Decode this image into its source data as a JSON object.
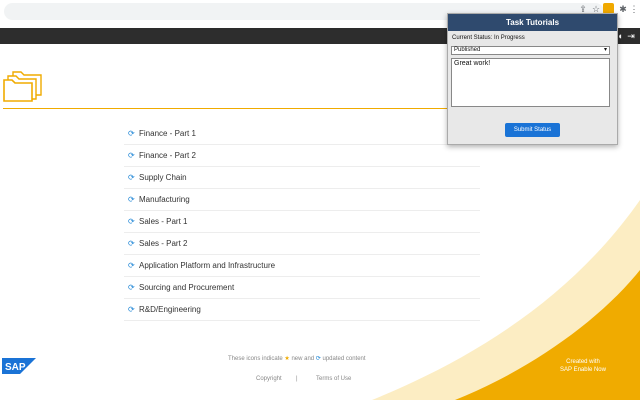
{
  "popup": {
    "title": "Task Tutorials",
    "status_label": "Current Status:",
    "status_value": "In Progress",
    "selected_status": "Published",
    "comment": "Great work!",
    "submit_label": "Submit Status"
  },
  "courses": [
    "Finance - Part 1",
    "Finance - Part 2",
    "Supply Chain",
    "Manufacturing",
    "Sales - Part 1",
    "Sales - Part 2",
    "Application Platform and Infrastructure",
    "Sourcing and Procurement",
    "R&D/Engineering"
  ],
  "legend": {
    "prefix": "These icons indicate",
    "new": "new and",
    "updated": "updated content"
  },
  "footer": {
    "copyright": "Copyright",
    "separator": "|",
    "terms": "Terms of Use",
    "created_line1": "Created with",
    "created_line2": "SAP Enable Now"
  },
  "logo": {
    "text": "SAP"
  },
  "colors": {
    "accent": "#f0ab00",
    "popup_header": "#2f4a6e",
    "button": "#1a73d6",
    "toolbar": "#2d2d2d",
    "update_icon": "#1f86d6"
  },
  "icons": [
    "share-icon",
    "star-icon",
    "extension-icon",
    "puzzle-icon",
    "menu-icon",
    "folder-icon",
    "refresh-icon",
    "exit-icon"
  ]
}
